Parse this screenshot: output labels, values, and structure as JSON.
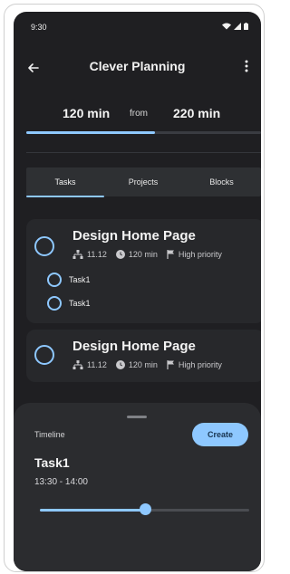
{
  "status_bar": {
    "time": "9:30",
    "icons": [
      "wifi-icon",
      "cell-signal-icon",
      "battery-icon"
    ]
  },
  "app_bar": {
    "title": "Clever Planning",
    "icons": [
      "arrow-back-icon",
      "more-vert-icon"
    ]
  },
  "summary": {
    "spent": "120 min",
    "from_label": "from",
    "total": "220 min",
    "progress_fraction": 0.55
  },
  "tabs": {
    "items": [
      "Tasks",
      "Projects",
      "Blocks"
    ],
    "active_index": 0
  },
  "cards": [
    {
      "title": "Design Home Page",
      "date": "11.12",
      "duration": "120 min",
      "priority": "High priority",
      "subtasks": [
        "Task1",
        "Task1"
      ]
    },
    {
      "title": "Design Home Page",
      "date": "11.12",
      "duration": "120 min",
      "priority": "High priority",
      "subtasks": []
    }
  ],
  "sheet": {
    "label": "Timeline",
    "create_label": "Create",
    "task_name": "Task1",
    "task_time": "13:30 - 14:00",
    "slider_fraction": 0.5
  },
  "colors": {
    "accent": "#8ec8ff",
    "background": "#1f1f22",
    "card": "#27282b",
    "sheet": "#2b2c2f"
  }
}
